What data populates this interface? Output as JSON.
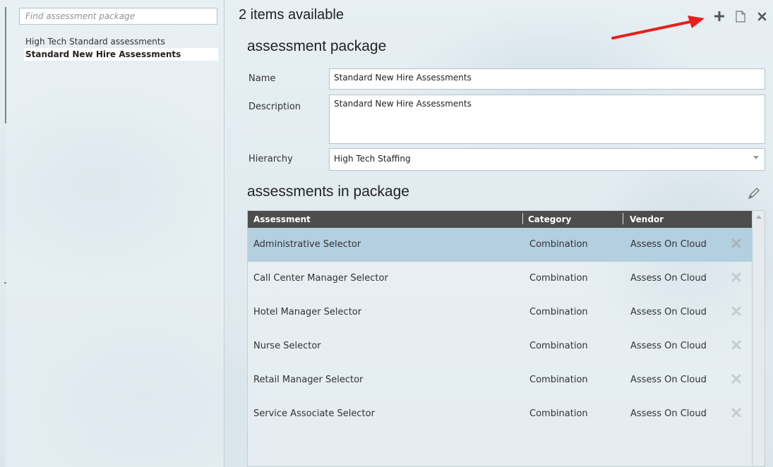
{
  "search": {
    "placeholder": "Find assessment package"
  },
  "packages": [
    {
      "label": "High Tech Standard assessments",
      "selected": false
    },
    {
      "label": "Standard New Hire Assessments",
      "selected": true
    }
  ],
  "header": {
    "title": "2 items available"
  },
  "toolbar": {
    "icons": [
      "plus-icon",
      "copy-icon",
      "close-icon"
    ]
  },
  "form": {
    "section_title": "assessment package",
    "name_label": "Name",
    "name_value": "Standard New Hire Assessments",
    "description_label": "Description",
    "description_value": "Standard New Hire Assessments",
    "hierarchy_label": "Hierarchy",
    "hierarchy_value": "High Tech Staffing"
  },
  "assessments": {
    "section_title": "assessments in package",
    "columns": [
      "Assessment",
      "Category",
      "Vendor"
    ],
    "rows": [
      {
        "assessment": "Administrative Selector",
        "category": "Combination",
        "vendor": "Assess On Cloud",
        "selected": true
      },
      {
        "assessment": "Call Center Manager Selector",
        "category": "Combination",
        "vendor": "Assess On Cloud",
        "selected": false
      },
      {
        "assessment": "Hotel Manager Selector",
        "category": "Combination",
        "vendor": "Assess On Cloud",
        "selected": false
      },
      {
        "assessment": "Nurse Selector",
        "category": "Combination",
        "vendor": "Assess On Cloud",
        "selected": false
      },
      {
        "assessment": "Retail Manager Selector",
        "category": "Combination",
        "vendor": "Assess On Cloud",
        "selected": false
      },
      {
        "assessment": "Service Associate Selector",
        "category": "Combination",
        "vendor": "Assess On Cloud",
        "selected": false
      }
    ]
  },
  "colors": {
    "annotation_arrow": "#e8201c",
    "grid_header": "#4d4d4d",
    "selected_row": "#b3cfe0"
  }
}
